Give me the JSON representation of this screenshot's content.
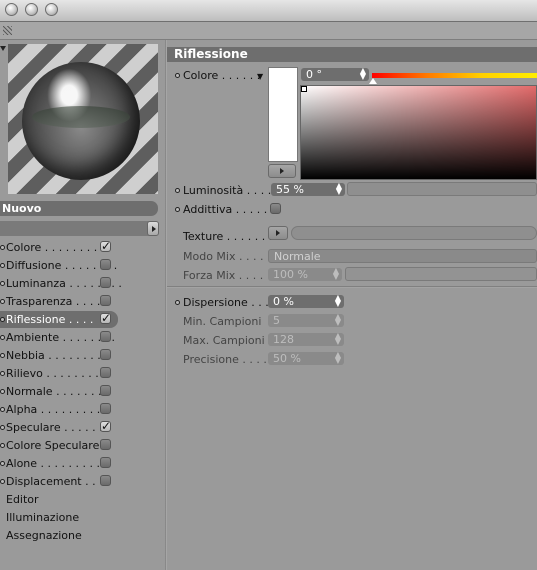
{
  "material_name": "Nuovo",
  "channels": [
    {
      "label": "Colore",
      "checked": true
    },
    {
      "label": "Diffusione",
      "checked": false
    },
    {
      "label": "Luminanza",
      "checked": false
    },
    {
      "label": "Trasparenza",
      "checked": false
    },
    {
      "label": "Riflessione",
      "checked": true
    },
    {
      "label": "Ambiente",
      "checked": false
    },
    {
      "label": "Nebbia",
      "checked": false
    },
    {
      "label": "Rilievo",
      "checked": false
    },
    {
      "label": "Normale",
      "checked": false
    },
    {
      "label": "Alpha",
      "checked": false
    },
    {
      "label": "Speculare",
      "checked": true
    },
    {
      "label": "Colore Speculare",
      "checked": false
    },
    {
      "label": "Alone",
      "checked": false
    },
    {
      "label": "Displacement",
      "checked": false
    }
  ],
  "extra_items": [
    "Editor",
    "Illuminazione",
    "Assegnazione"
  ],
  "section_title": "Riflessione",
  "fields": {
    "colore_label": "Colore",
    "hue_value": "0 °",
    "luminosita_label": "Luminosità",
    "luminosita_value": "55 %",
    "additiva_label": "Addittiva",
    "texture_label": "Texture",
    "modo_mix_label": "Modo Mix",
    "modo_mix_value": "Normale",
    "forza_mix_label": "Forza Mix",
    "forza_mix_value": "100 %",
    "dispersione_label": "Dispersione",
    "dispersione_value": "0 %",
    "min_campioni_label": "Min. Campioni",
    "min_campioni_value": "5",
    "max_campioni_label": "Max. Campioni",
    "max_campioni_value": "128",
    "precisione_label": "Precisione",
    "precisione_value": "50 %"
  },
  "colors": {
    "panel": "#9a9a9a",
    "active": "#6e6e6e",
    "hue_start": "#ff0000"
  }
}
